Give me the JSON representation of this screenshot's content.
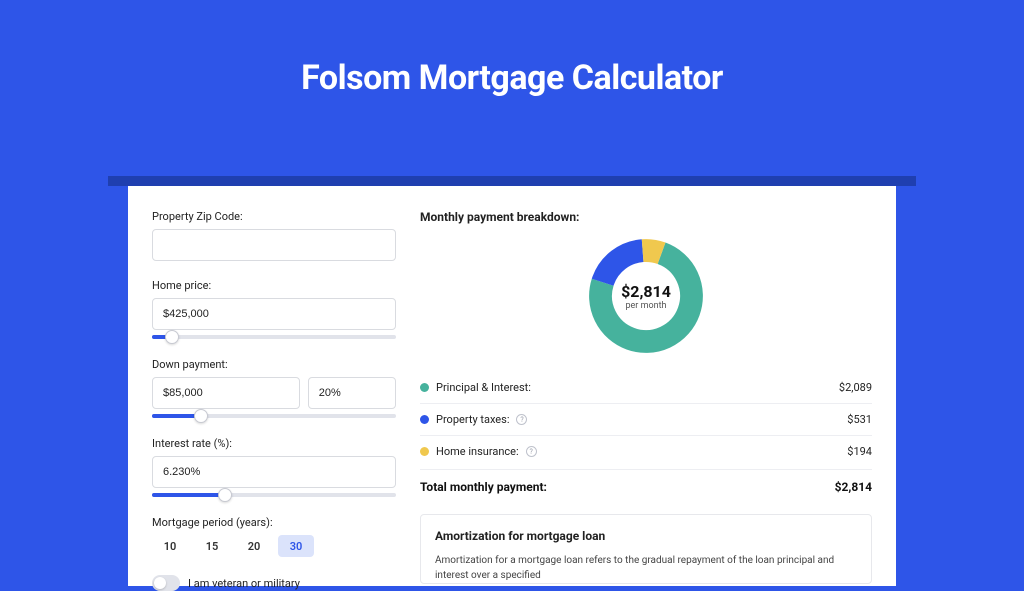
{
  "page_title": "Folsom Mortgage Calculator",
  "form": {
    "zip_label": "Property Zip Code:",
    "zip_value": "",
    "home_price_label": "Home price:",
    "home_price_value": "$425,000",
    "home_price_slider_pct": 8,
    "down_payment_label": "Down payment:",
    "down_payment_amount": "$85,000",
    "down_payment_pct": "20%",
    "down_payment_slider_pct": 20,
    "interest_rate_label": "Interest rate (%):",
    "interest_rate_value": "6.230%",
    "interest_rate_slider_pct": 30,
    "period_label": "Mortgage period (years):",
    "periods": [
      "10",
      "15",
      "20",
      "30"
    ],
    "period_active": "30",
    "veteran_label": "I am veteran or military"
  },
  "breakdown": {
    "title": "Monthly payment breakdown:",
    "center_amount": "$2,814",
    "center_sub": "per month",
    "rows": [
      {
        "label": "Principal & Interest:",
        "amount": "$2,089",
        "color": "pi",
        "help": false
      },
      {
        "label": "Property taxes:",
        "amount": "$531",
        "color": "tax",
        "help": true
      },
      {
        "label": "Home insurance:",
        "amount": "$194",
        "color": "ins",
        "help": true
      }
    ],
    "total_label": "Total monthly payment:",
    "total_amount": "$2,814"
  },
  "chart_data": {
    "type": "pie",
    "title": "Monthly payment breakdown",
    "series": [
      {
        "name": "Principal & Interest",
        "value": 2089,
        "color": "#46b29d"
      },
      {
        "name": "Property taxes",
        "value": 531,
        "color": "#2e55e8"
      },
      {
        "name": "Home insurance",
        "value": 194,
        "color": "#f0c84e"
      }
    ],
    "total": 2814,
    "unit": "USD per month"
  },
  "amortization": {
    "title": "Amortization for mortgage loan",
    "text": "Amortization for a mortgage loan refers to the gradual repayment of the loan principal and interest over a specified"
  }
}
